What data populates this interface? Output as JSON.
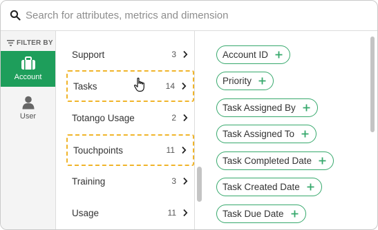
{
  "search": {
    "placeholder": "Search for attributes, metrics and dimension",
    "value": ""
  },
  "rail": {
    "filter_label": "FILTER BY",
    "account_label": "Account",
    "user_label": "User"
  },
  "categories": [
    {
      "label": "Support",
      "count": "3"
    },
    {
      "label": "Tasks",
      "count": "14"
    },
    {
      "label": "Totango Usage",
      "count": "2"
    },
    {
      "label": "Touchpoints",
      "count": "11"
    },
    {
      "label": "Training",
      "count": "3"
    },
    {
      "label": "Usage",
      "count": "11"
    }
  ],
  "attributes": [
    {
      "label": "Account ID"
    },
    {
      "label": "Priority"
    },
    {
      "label": "Task Assigned By"
    },
    {
      "label": "Task Assigned To"
    },
    {
      "label": "Task Completed Date"
    },
    {
      "label": "Task Created Date"
    },
    {
      "label": "Task Due Date"
    }
  ],
  "colors": {
    "accent": "#1e9e5b",
    "chip_border": "#35a86b",
    "highlight": "#f0b429"
  },
  "icons": [
    "search-icon",
    "filter-icon",
    "briefcase-icon",
    "user-icon",
    "chevron-right-icon",
    "plus-icon",
    "hand-cursor-icon"
  ]
}
